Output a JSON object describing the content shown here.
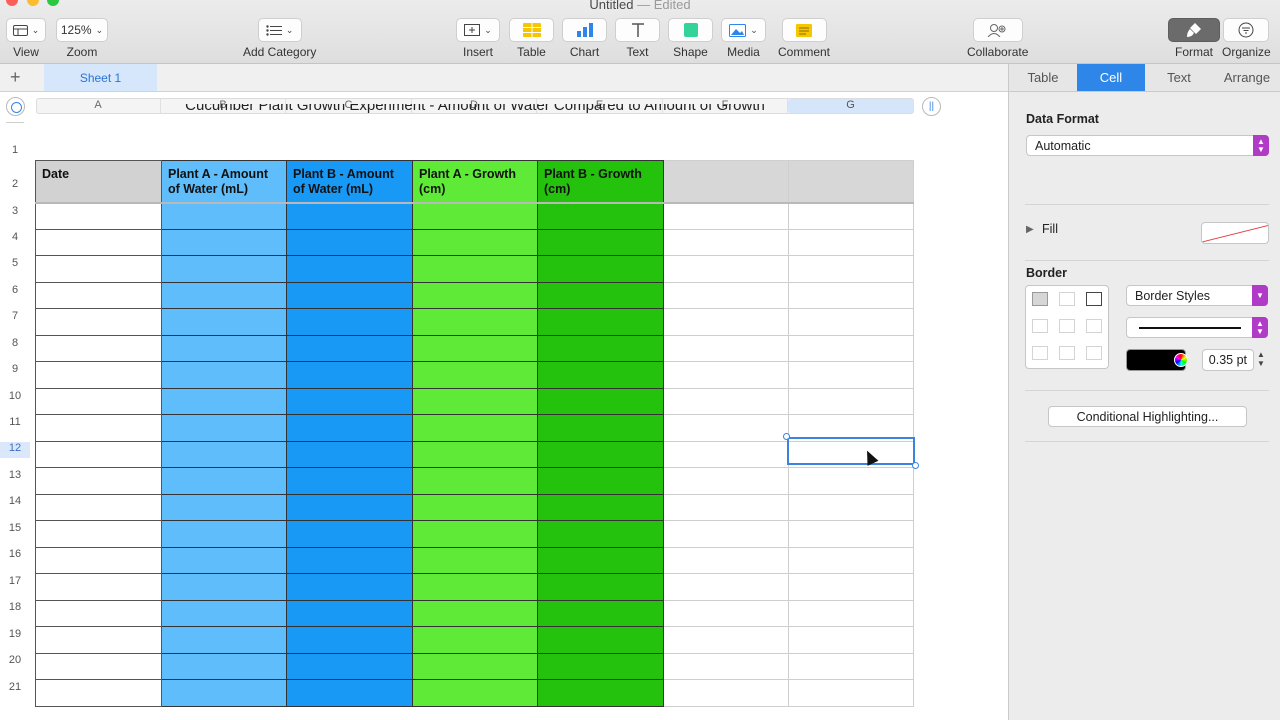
{
  "window": {
    "title": "Untitled",
    "status": "— Edited"
  },
  "toolbar": {
    "view_label": "View",
    "zoom_value": "125%",
    "zoom_label": "Zoom",
    "add_category_label": "Add Category",
    "insert_label": "Insert",
    "table_label": "Table",
    "chart_label": "Chart",
    "text_label": "Text",
    "shape_label": "Shape",
    "media_label": "Media",
    "comment_label": "Comment",
    "collaborate_label": "Collaborate",
    "format_label": "Format",
    "organize_label": "Organize"
  },
  "sheet_tabs": {
    "add": "+",
    "active": "Sheet 1"
  },
  "columns": [
    "A",
    "B",
    "C",
    "D",
    "E",
    "F",
    "G"
  ],
  "selected_column": "G",
  "rows": [
    "1",
    "2",
    "3",
    "4",
    "5",
    "6",
    "7",
    "8",
    "9",
    "10",
    "11",
    "12",
    "13",
    "14",
    "15",
    "16",
    "17",
    "18",
    "19",
    "20",
    "21"
  ],
  "selected_row": "12",
  "sheet": {
    "title": "Cucumber Plant Growth Experiment  - Amount of Water Compared to Amount of Growth",
    "headers": [
      "Date",
      "Plant A - Amount of Water (mL)",
      "Plant B - Amount of Water (mL)",
      "Plant A - Growth (cm)",
      "Plant B - Growth (cm)",
      "",
      ""
    ]
  },
  "colors": {
    "col_b": "#5ebdfa",
    "col_c": "#1899f5",
    "col_d": "#5eea36",
    "col_e": "#25c20d",
    "accent": "#2e86e8",
    "popup_accent": "#b03bc6"
  },
  "inspector": {
    "tabs": [
      "Table",
      "Cell",
      "Text",
      "Arrange"
    ],
    "active_tab": "Cell",
    "data_format_title": "Data Format",
    "data_format_value": "Automatic",
    "fill_label": "Fill",
    "border_title": "Border",
    "border_styles": "Border Styles",
    "border_width": "0.35 pt",
    "conditional_button": "Conditional Highlighting..."
  }
}
